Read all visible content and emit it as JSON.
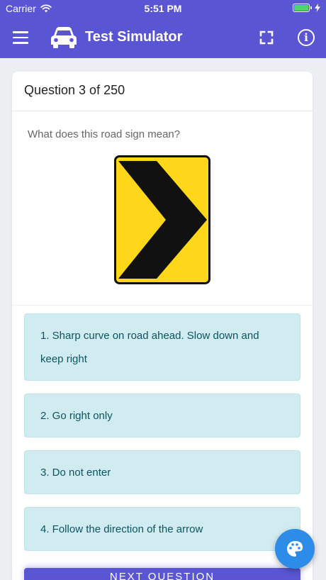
{
  "status_bar": {
    "carrier": "Carrier",
    "time": "5:51 PM"
  },
  "app_bar": {
    "title": "Test Simulator",
    "icons": [
      "menu-icon",
      "car-icon",
      "fullscreen-icon",
      "info-icon"
    ]
  },
  "quiz": {
    "header": "Question 3 of 250",
    "question": "What does this road sign mean?",
    "sign": {
      "type": "chevron-right-warning-sign",
      "background_color": "#ffd71a",
      "symbol_color": "#111111"
    },
    "options": [
      "1. Sharp curve on road ahead. Slow down and keep right",
      "2. Go right only",
      "3. Do not enter",
      "4. Follow the direction of the arrow"
    ],
    "next_label": "NEXT QUESTION"
  },
  "colors": {
    "primary": "#5a55d2",
    "option_bg": "#d1ecf1",
    "option_text": "#0c5460",
    "fab": "#2d8ce8"
  },
  "fab": {
    "icon": "palette-icon"
  }
}
